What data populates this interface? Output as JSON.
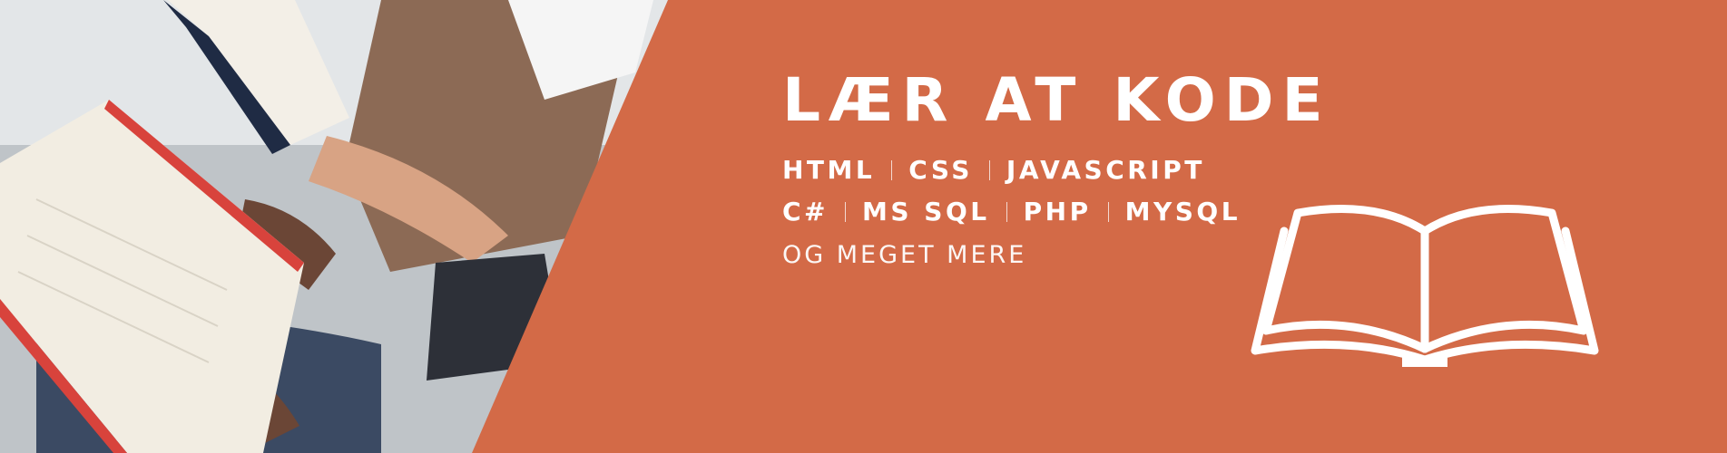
{
  "banner": {
    "headline": "LÆR AT KODE",
    "tech_row_1": [
      "HTML",
      "CSS",
      "JAVASCRIPT"
    ],
    "tech_row_2": [
      "C#",
      "MS SQL",
      "PHP",
      "MYSQL"
    ],
    "tagline": "OG MEGET MERE",
    "accent_color": "#d36a47",
    "text_color": "#ffffff"
  },
  "icons": {
    "book": "open-book-icon"
  }
}
